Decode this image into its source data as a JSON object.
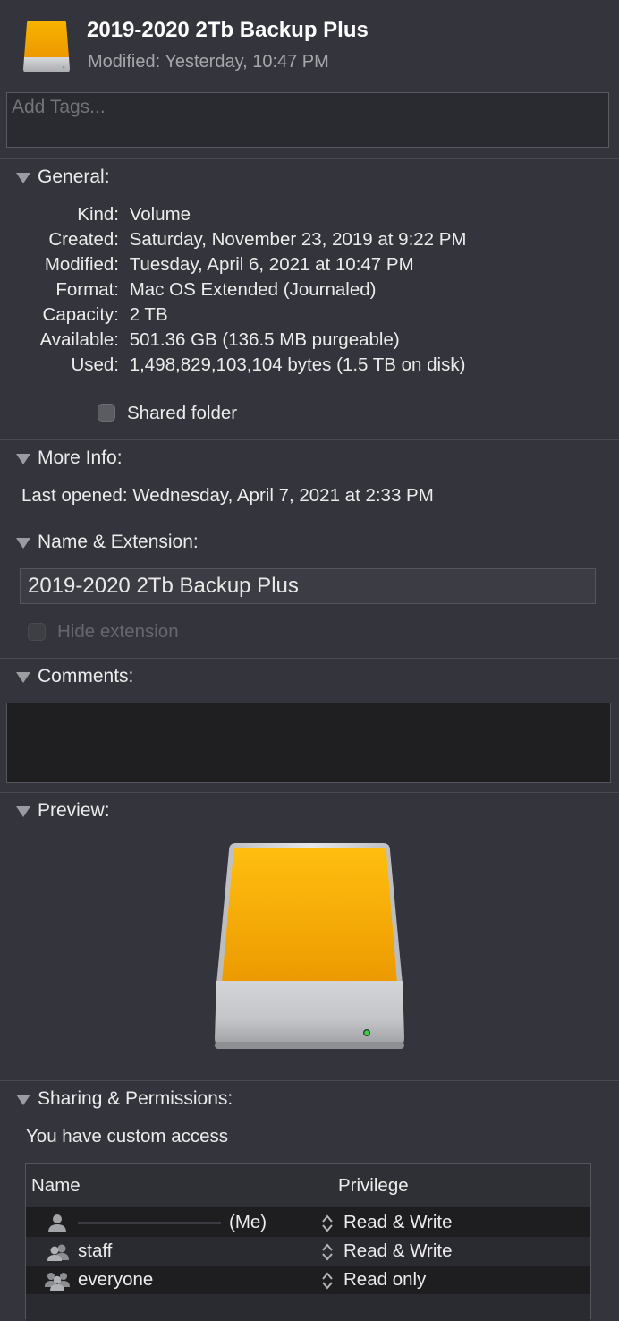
{
  "header": {
    "title": "2019-2020 2Tb Backup Plus",
    "modified_label": "Modified:",
    "modified_value": "Yesterday, 10:47 PM"
  },
  "tags": {
    "placeholder": "Add Tags..."
  },
  "general": {
    "title": "General:",
    "rows": [
      {
        "label": "Kind:",
        "value": "Volume"
      },
      {
        "label": "Created:",
        "value": "Saturday, November 23, 2019 at 9:22 PM"
      },
      {
        "label": "Modified:",
        "value": "Tuesday, April 6, 2021 at 10:47 PM"
      },
      {
        "label": "Format:",
        "value": "Mac OS Extended (Journaled)"
      },
      {
        "label": "Capacity:",
        "value": "2 TB"
      },
      {
        "label": "Available:",
        "value": "501.36 GB (136.5 MB purgeable)"
      },
      {
        "label": "Used:",
        "value": "1,498,829,103,104 bytes (1.5 TB on disk)"
      }
    ],
    "shared_folder_label": "Shared folder"
  },
  "more_info": {
    "title": "More Info:",
    "last_opened_label": "Last opened:",
    "last_opened_value": "Wednesday, April 7, 2021 at 2:33 PM"
  },
  "name_extension": {
    "title": "Name & Extension:",
    "name_value": "2019-2020 2Tb Backup Plus",
    "hide_extension_label": "Hide extension"
  },
  "comments": {
    "title": "Comments:"
  },
  "preview": {
    "title": "Preview:"
  },
  "sharing": {
    "title": "Sharing & Permissions:",
    "access_text": "You have custom access",
    "columns": [
      "Name",
      "Privilege"
    ],
    "rows": [
      {
        "name": "(Me)",
        "icon": "person-icon",
        "privilege": "Read & Write"
      },
      {
        "name": "staff",
        "icon": "group-icon",
        "privilege": "Read & Write"
      },
      {
        "name": "everyone",
        "icon": "everyone-icon",
        "privilege": "Read only"
      }
    ]
  },
  "colors": {
    "background": "#33343c",
    "drive_orange": "#f5a800",
    "drive_silver": "#c8c9cc",
    "led_green": "#3cd23c"
  }
}
